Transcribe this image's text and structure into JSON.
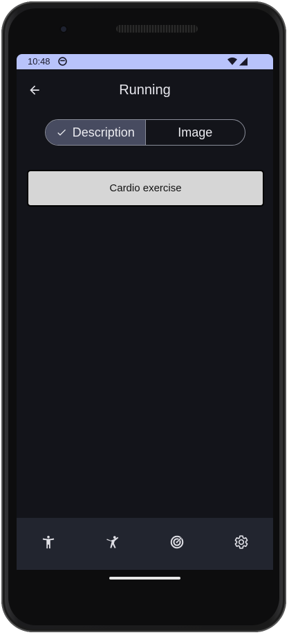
{
  "status_bar": {
    "time": "10:48"
  },
  "top_bar": {
    "title": "Running"
  },
  "segmented": {
    "options": [
      {
        "label": "Description",
        "selected": true
      },
      {
        "label": "Image",
        "selected": false
      }
    ]
  },
  "content": {
    "card_text": "Cardio exercise"
  },
  "bottom_nav": {
    "items": [
      {
        "icon": "accessibility-icon"
      },
      {
        "icon": "martial-arts-icon"
      },
      {
        "icon": "target-icon"
      },
      {
        "icon": "settings-icon"
      }
    ]
  },
  "colors": {
    "status_bar": "#b8c3fb",
    "background": "#13141a",
    "segment_selected": "#474b60",
    "card": "#d6d6d6",
    "nav_bar": "#22252f"
  }
}
